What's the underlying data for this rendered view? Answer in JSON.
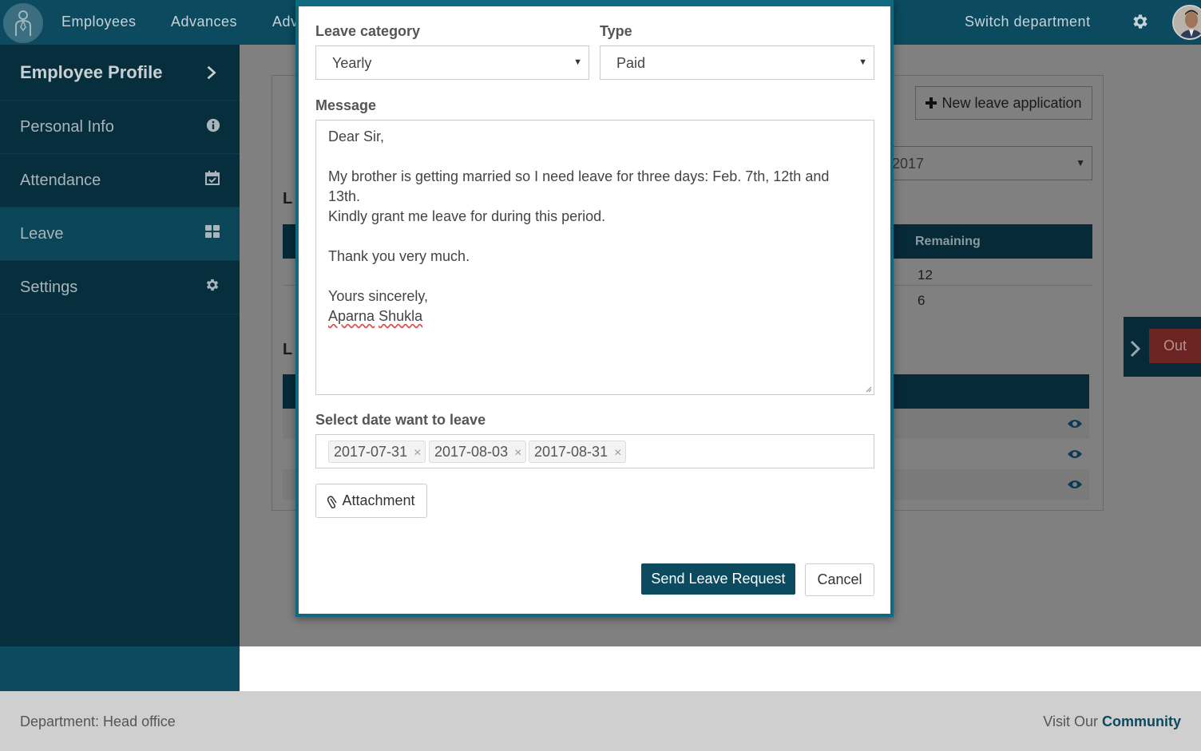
{
  "topnav": {
    "items": [
      "Employees",
      "Advances",
      "Adv"
    ],
    "switch_department": "Switch department"
  },
  "sidebar": {
    "profile_label": "Employee Profile",
    "items": [
      {
        "label": "Personal Info",
        "icon": "info-icon"
      },
      {
        "label": "Attendance",
        "icon": "calendar-check-icon"
      },
      {
        "label": "Leave",
        "icon": "grid-icon",
        "active": true
      },
      {
        "label": "Settings",
        "icon": "gear-icon"
      }
    ]
  },
  "background": {
    "new_leave_label": "New leave application",
    "year_value": "2017",
    "section_initial_1": "L",
    "section_initial_2": "L",
    "remaining_header": "Remaining",
    "remaining_values": [
      "12",
      "6"
    ]
  },
  "clock": {
    "out_label": "Out"
  },
  "modal": {
    "leave_category_label": "Leave category",
    "leave_category_value": "Yearly",
    "type_label": "Type",
    "type_value": "Paid",
    "message_label": "Message",
    "message_lines": [
      "Dear Sir,",
      "",
      "My brother is getting married so I need leave for three days: Feb. 7th, 12th and 13th.",
      "Kindly grant me leave for during this period.",
      "",
      "Thank you very much.",
      "",
      "Yours sincerely,"
    ],
    "signature_first": "Aparna",
    "signature_last": "Shukla",
    "date_label": "Select date want to leave",
    "dates": [
      "2017-07-31",
      "2017-08-03",
      "2017-08-31"
    ],
    "attachment_label": "Attachment",
    "send_label": "Send Leave Request",
    "cancel_label": "Cancel"
  },
  "footer": {
    "department": "Department: Head office",
    "visit_text": "Visit Our",
    "community": "Community"
  },
  "colors": {
    "primary": "#0b4a5f",
    "sidebar": "#072e3c",
    "modal_border": "#0f6a80",
    "out_button": "#d9534f"
  }
}
